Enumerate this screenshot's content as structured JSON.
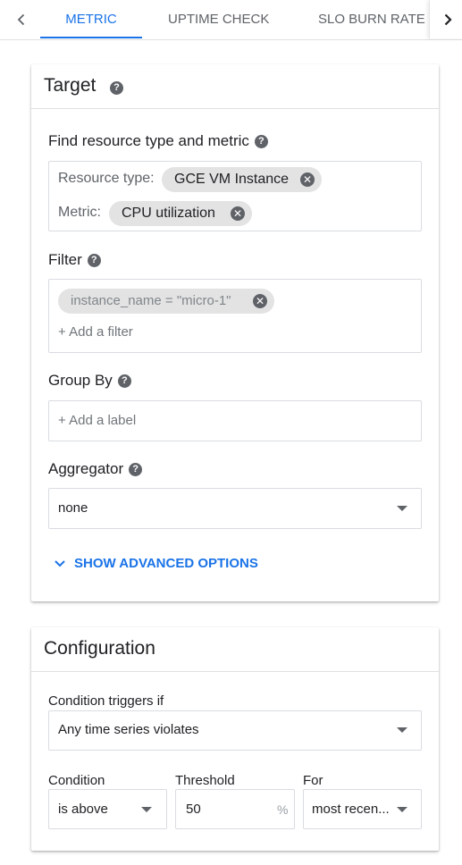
{
  "tabs": {
    "items": [
      {
        "label": "METRIC",
        "active": true
      },
      {
        "label": "UPTIME CHECK",
        "active": false
      },
      {
        "label": "SLO BURN RATE",
        "active": false
      }
    ]
  },
  "target": {
    "title": "Target",
    "find_label": "Find resource type and metric",
    "resource_type_key": "Resource type:",
    "resource_type_value": "GCE VM Instance",
    "metric_key": "Metric:",
    "metric_value": "CPU utilization",
    "filter_label": "Filter",
    "filter_chip": "instance_name = \"micro-1\"",
    "add_filter": "+ Add a filter",
    "group_by_label": "Group By",
    "add_label_placeholder": "+ Add a label",
    "aggregator_label": "Aggregator",
    "aggregator_value": "none",
    "advanced_link": "SHOW ADVANCED OPTIONS"
  },
  "configuration": {
    "title": "Configuration",
    "condition_triggers_label": "Condition triggers if",
    "condition_triggers_value": "Any time series violates",
    "condition_label": "Condition",
    "condition_value": "is above",
    "threshold_label": "Threshold",
    "threshold_value": "50",
    "threshold_unit": "%",
    "for_label": "For",
    "for_value": "most recen..."
  },
  "colors": {
    "accent": "#1a73e8",
    "text": "#202124",
    "secondary_text": "#5f6368",
    "chip_bg": "#e3e3e3",
    "border": "#dadce0"
  }
}
